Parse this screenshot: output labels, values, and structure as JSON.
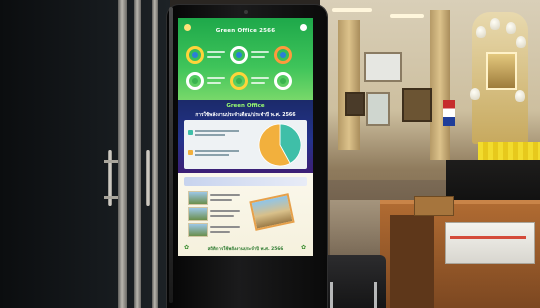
{
  "kiosk": {
    "poster_title": "Green Office 2566",
    "section2_title": "Green Office",
    "section2_subtitle": "การใช้พลังงานประจำเดือน/ประจำปี พ.ศ. 2566",
    "footer_text": "สถิติการใช้พลังงานประจำปี พ.ศ. 2566"
  },
  "chart_data": {
    "type": "pie",
    "title": "",
    "slices": [
      {
        "label": "",
        "value": 42,
        "color": "#3fbfa8"
      },
      {
        "label": "",
        "value": 58,
        "color": "#f2b03d"
      }
    ]
  },
  "colors": {
    "poster_green": "#1ea84a",
    "section_blue": "#24338c",
    "pie_teal": "#3fbfa8",
    "pie_orange": "#f2b03d"
  }
}
